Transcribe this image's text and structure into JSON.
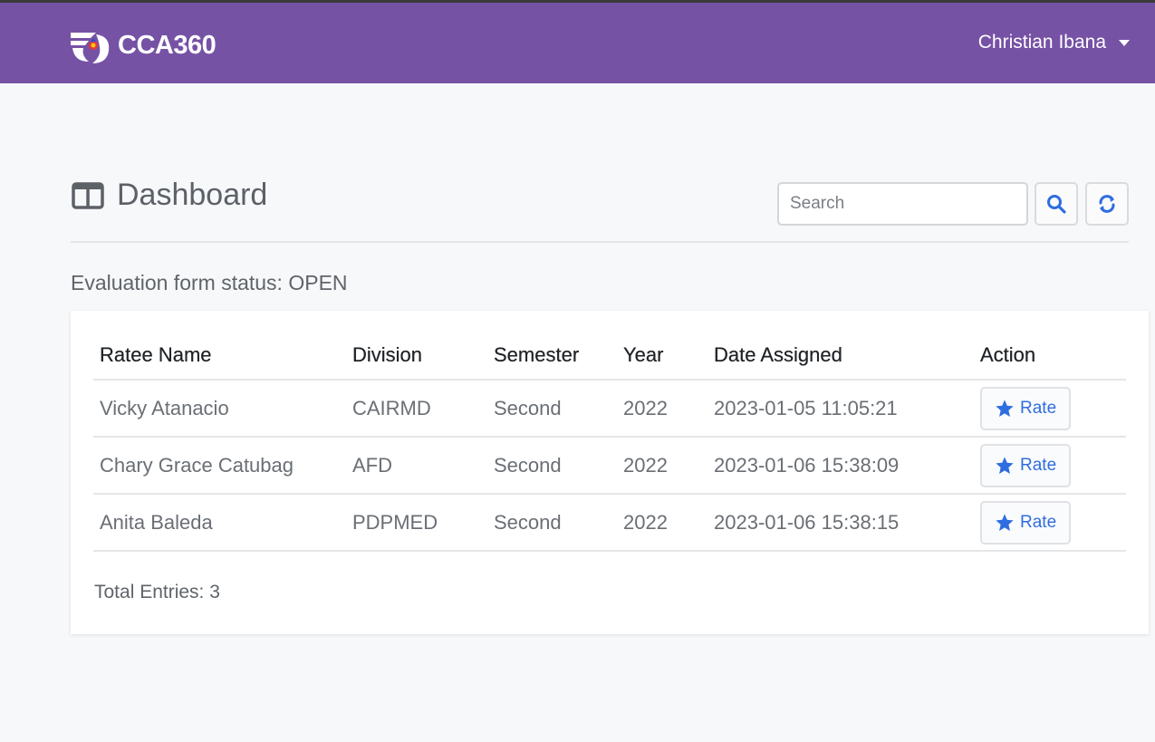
{
  "navbar": {
    "brand": "CCA360",
    "user_name": "Christian Ibana",
    "bg_color": "#7652a5"
  },
  "page": {
    "title": "Dashboard",
    "status_text": "Evaluation form status: OPEN"
  },
  "search": {
    "placeholder": "Search"
  },
  "table": {
    "headers": [
      "Ratee Name",
      "Division",
      "Semester",
      "Year",
      "Date Assigned",
      "Action"
    ],
    "rows": [
      {
        "name": "Vicky Atanacio",
        "division": "CAIRMD",
        "semester": "Second",
        "year": "2022",
        "date": "2023-01-05 11:05:21",
        "action": "Rate"
      },
      {
        "name": "Chary Grace Catubag",
        "division": "AFD",
        "semester": "Second",
        "year": "2022",
        "date": "2023-01-06 15:38:09",
        "action": "Rate"
      },
      {
        "name": "Anita Baleda",
        "division": "PDPMED",
        "semester": "Second",
        "year": "2022",
        "date": "2023-01-06 15:38:15",
        "action": "Rate"
      }
    ]
  },
  "footer": {
    "total_entries": "Total Entries: 3"
  },
  "icons": {
    "logo": "cca360-logo-icon",
    "user_menu": "caret-down-icon",
    "title": "dashboard-columns-icon",
    "search": "search-icon",
    "refresh": "refresh-icon",
    "rate": "star-icon"
  },
  "colors": {
    "accent": "#2f6de0",
    "nav": "#7652a5"
  }
}
